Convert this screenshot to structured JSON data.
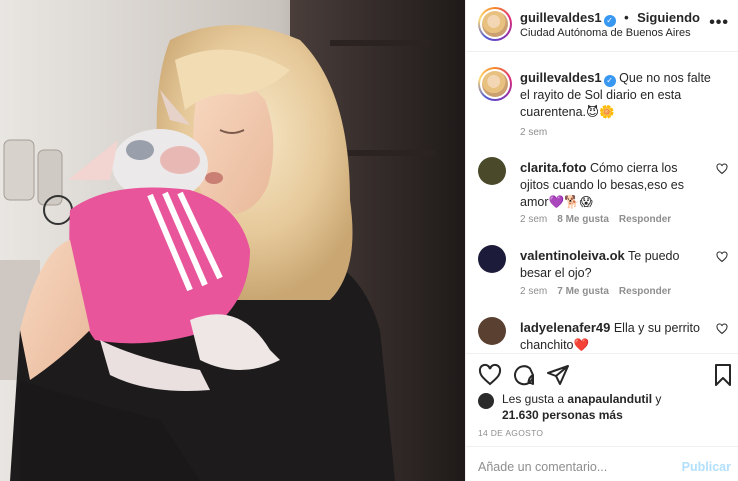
{
  "header": {
    "username": "guillevaldes1",
    "separator": "•",
    "following_label": "Siguiendo",
    "location": "Ciudad Autónoma de Buenos Aires",
    "more_icon": "more-horizontal-icon"
  },
  "caption": {
    "username": "guillevaldes1",
    "text": "Que no nos falte el rayito de Sol diario en esta cuarentena.😈🌼",
    "time": "2 sem"
  },
  "comments": [
    {
      "username": "clarita.foto",
      "text": "Cómo cierra los ojitos cuando lo besas,eso es amor💜🐕😱",
      "time": "2 sem",
      "likes": "8 Me gusta",
      "reply": "Responder",
      "avatar_color": "#4a4a2a"
    },
    {
      "username": "valentinoleiva.ok",
      "text": "Te puedo besar el ojo?",
      "time": "2 sem",
      "likes": "7 Me gusta",
      "reply": "Responder",
      "avatar_color": "#1c1c3a"
    },
    {
      "username": "ladyelenafer49",
      "text": "Ella y su perrito chanchito❤️",
      "avatar_color": "#5a4030"
    }
  ],
  "likes": {
    "prefix": "Les gusta a",
    "first_user": "anapaulandutil",
    "conjunction": "y",
    "others": "21.630 personas más"
  },
  "date": "14 DE AGOSTO",
  "add_comment": {
    "placeholder": "Añade un comentario...",
    "publish_label": "Publicar"
  },
  "icons": [
    "heart-icon",
    "comment-icon",
    "share-icon",
    "bookmark-icon",
    "verified-badge-icon"
  ],
  "colors": {
    "verified": "#3897f0",
    "publish_disabled": "#b2dffc",
    "meta_gray": "#8e8e8e",
    "shirt_pink": "#e8559a"
  }
}
